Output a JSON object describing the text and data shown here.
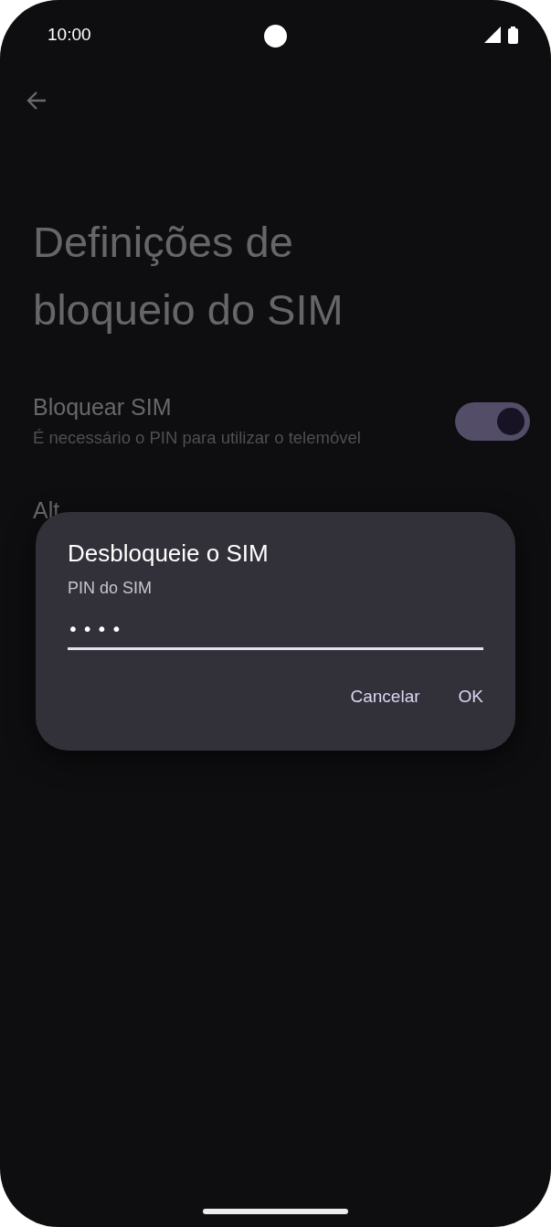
{
  "status_bar": {
    "time": "10:00"
  },
  "page": {
    "title": "Definições de bloqueio do SIM",
    "settings": [
      {
        "kind": "toggle",
        "title": "Bloquear SIM",
        "subtitle": "É necessário o PIN para utilizar o telemóvel",
        "on": true
      },
      {
        "kind": "plain",
        "title": "Alt"
      }
    ]
  },
  "dialog": {
    "title": "Desbloqueie o SIM",
    "field_label": "PIN do SIM",
    "field_value": "••••",
    "buttons": [
      "Cancelar",
      "OK"
    ]
  }
}
